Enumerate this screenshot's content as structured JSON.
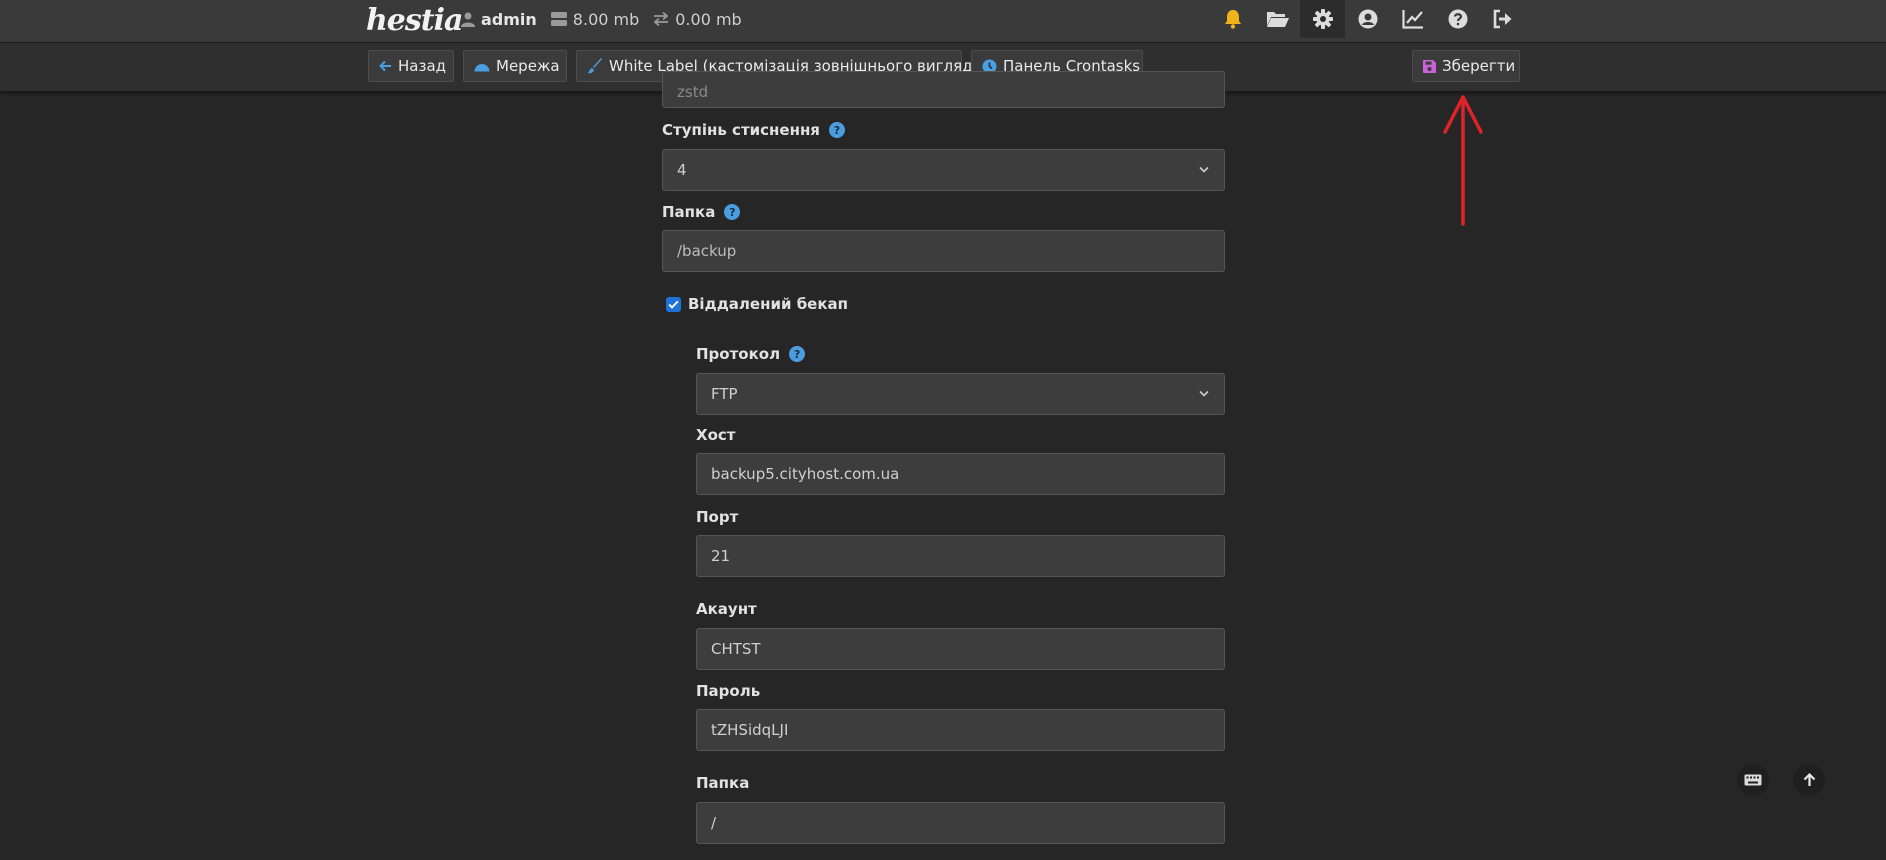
{
  "header": {
    "logo_text": "hestia",
    "user": {
      "name": "admin",
      "disk": "8.00 mb",
      "bandwidth": "0.00 mb"
    },
    "icons": [
      "bell-icon",
      "folder-open-icon",
      "gear-icon",
      "user-circle-icon",
      "chart-line-icon",
      "question-icon",
      "logout-icon"
    ]
  },
  "toolbar": {
    "back_label": "Назад",
    "network_label": "Мережа",
    "white_label_label": "White Label (кастомізація зовнішнього вигляду)",
    "crontasks_label": "Панель Crontasks",
    "save_label": "Зберегти"
  },
  "form": {
    "partial_value": "zstd",
    "compression": {
      "label": "Ступінь стиснення",
      "value": "4"
    },
    "folder": {
      "label": "Папка",
      "value": "/backup"
    },
    "remote_backup": {
      "label": "Віддалений бекап",
      "checked": true
    },
    "protocol": {
      "label": "Протокол",
      "value": "FTP"
    },
    "host": {
      "label": "Хост",
      "value": "backup5.cityhost.com.ua"
    },
    "port": {
      "label": "Порт",
      "value": "21"
    },
    "account": {
      "label": "Акаунт",
      "value": "CHTST"
    },
    "password": {
      "label": "Пароль",
      "value": "tZHSidqLJI"
    },
    "remote_folder": {
      "label": "Папка",
      "value": "/"
    }
  },
  "colors": {
    "accent": "#4a9ee0",
    "bell": "#f0b31b",
    "annotation": "#e0232a",
    "save_icon": "#c864d8"
  }
}
